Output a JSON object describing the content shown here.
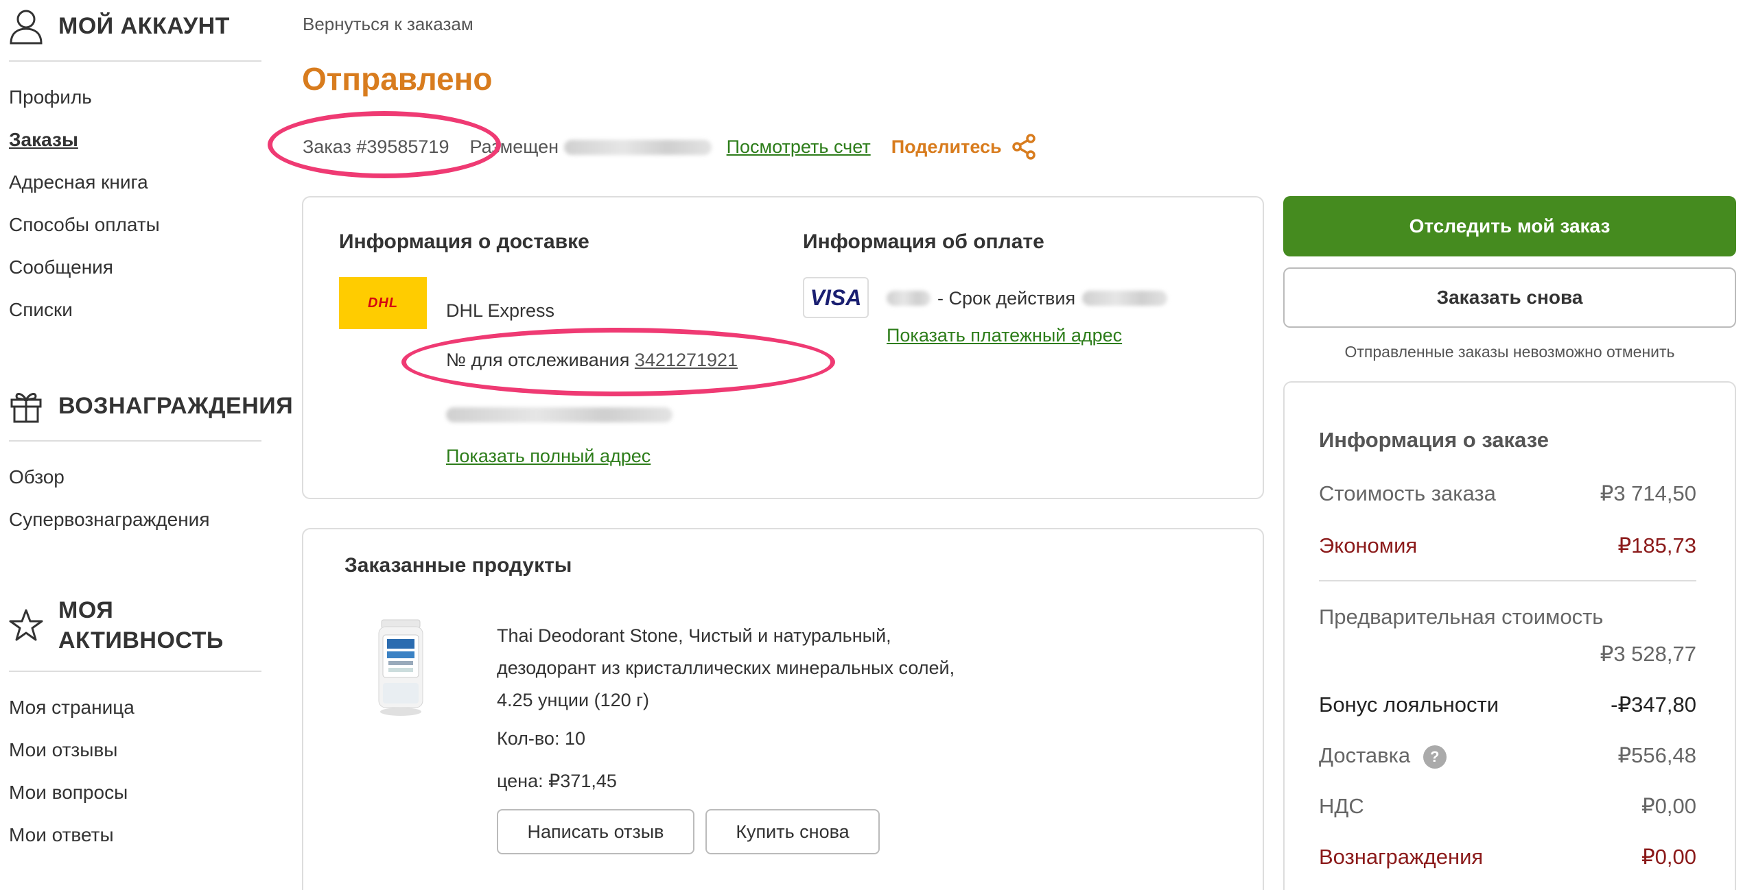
{
  "sidebar": {
    "account": {
      "title": "МОЙ АККАУНТ",
      "icon": "user-icon",
      "items": [
        "Профиль",
        "Заказы",
        "Адресная книга",
        "Способы оплаты",
        "Сообщения",
        "Списки"
      ],
      "active": "Заказы"
    },
    "rewards": {
      "title": "ВОЗНАГРАЖДЕНИЯ",
      "icon": "gift-icon",
      "items": [
        "Обзор",
        "Супервознаграждения"
      ]
    },
    "activity": {
      "title_line1": "МОЯ",
      "title_line2": "АКТИВНОСТЬ",
      "icon": "star-icon",
      "items": [
        "Моя страница",
        "Мои отзывы",
        "Мои вопросы",
        "Мои ответы"
      ]
    }
  },
  "header": {
    "back_link": "Вернуться к заказам",
    "status": "Отправлено",
    "order_number": "Заказ #39585719",
    "placed_label": "Размещен",
    "view_invoice": "Посмотреть счет",
    "share": "Поделитесь",
    "share_icon": "share-icon"
  },
  "delivery": {
    "title": "Информация о доставке",
    "carrier_logo": "DHL",
    "carrier": "DHL Express",
    "tracking_label": "№ для отслеживания",
    "tracking_number": "3421271921",
    "show_full_address": "Показать полный адрес"
  },
  "payment": {
    "title": "Информация об оплате",
    "card_brand": "VISA",
    "expiry_label": "- Срок действия",
    "show_billing_address": "Показать платежный адрес"
  },
  "products": {
    "title": "Заказанные продукты",
    "items": [
      {
        "name_line1": "Thai Deodorant Stone, Чистый и натуральный,",
        "name_line2": "дезодорант из кристаллических минеральных солей,",
        "name_line3": "4.25 унции (120 г)",
        "quantity": "Кол-во: 10",
        "price": "цена: ₽371,45",
        "review_button": "Написать отзыв",
        "buy_again_button": "Купить снова"
      }
    ]
  },
  "actions": {
    "track_button": "Отследить мой заказ",
    "reorder_button": "Заказать снова",
    "cancel_note": "Отправленные заказы невозможно отменить"
  },
  "summary": {
    "title": "Информация о заказе",
    "order_cost_label": "Стоимость заказа",
    "order_cost_value": "₽3 714,50",
    "savings_label": "Экономия",
    "savings_value": "₽185,73",
    "subtotal_label": "Предварительная стоимость",
    "subtotal_value": "₽3 528,77",
    "loyalty_label": "Бонус лояльности",
    "loyalty_value": "-₽347,80",
    "shipping_label": "Доставка",
    "shipping_value": "₽556,48",
    "vat_label": "НДС",
    "vat_value": "₽0,00",
    "rewards_label": "Вознаграждения",
    "rewards_value": "₽0,00"
  },
  "colors": {
    "accent_orange": "#d87c1e",
    "primary_green": "#458b1f",
    "link_green": "#2d7d1a",
    "discount_red": "#8b1a1a",
    "annotation_pink": "#ef3a73"
  }
}
